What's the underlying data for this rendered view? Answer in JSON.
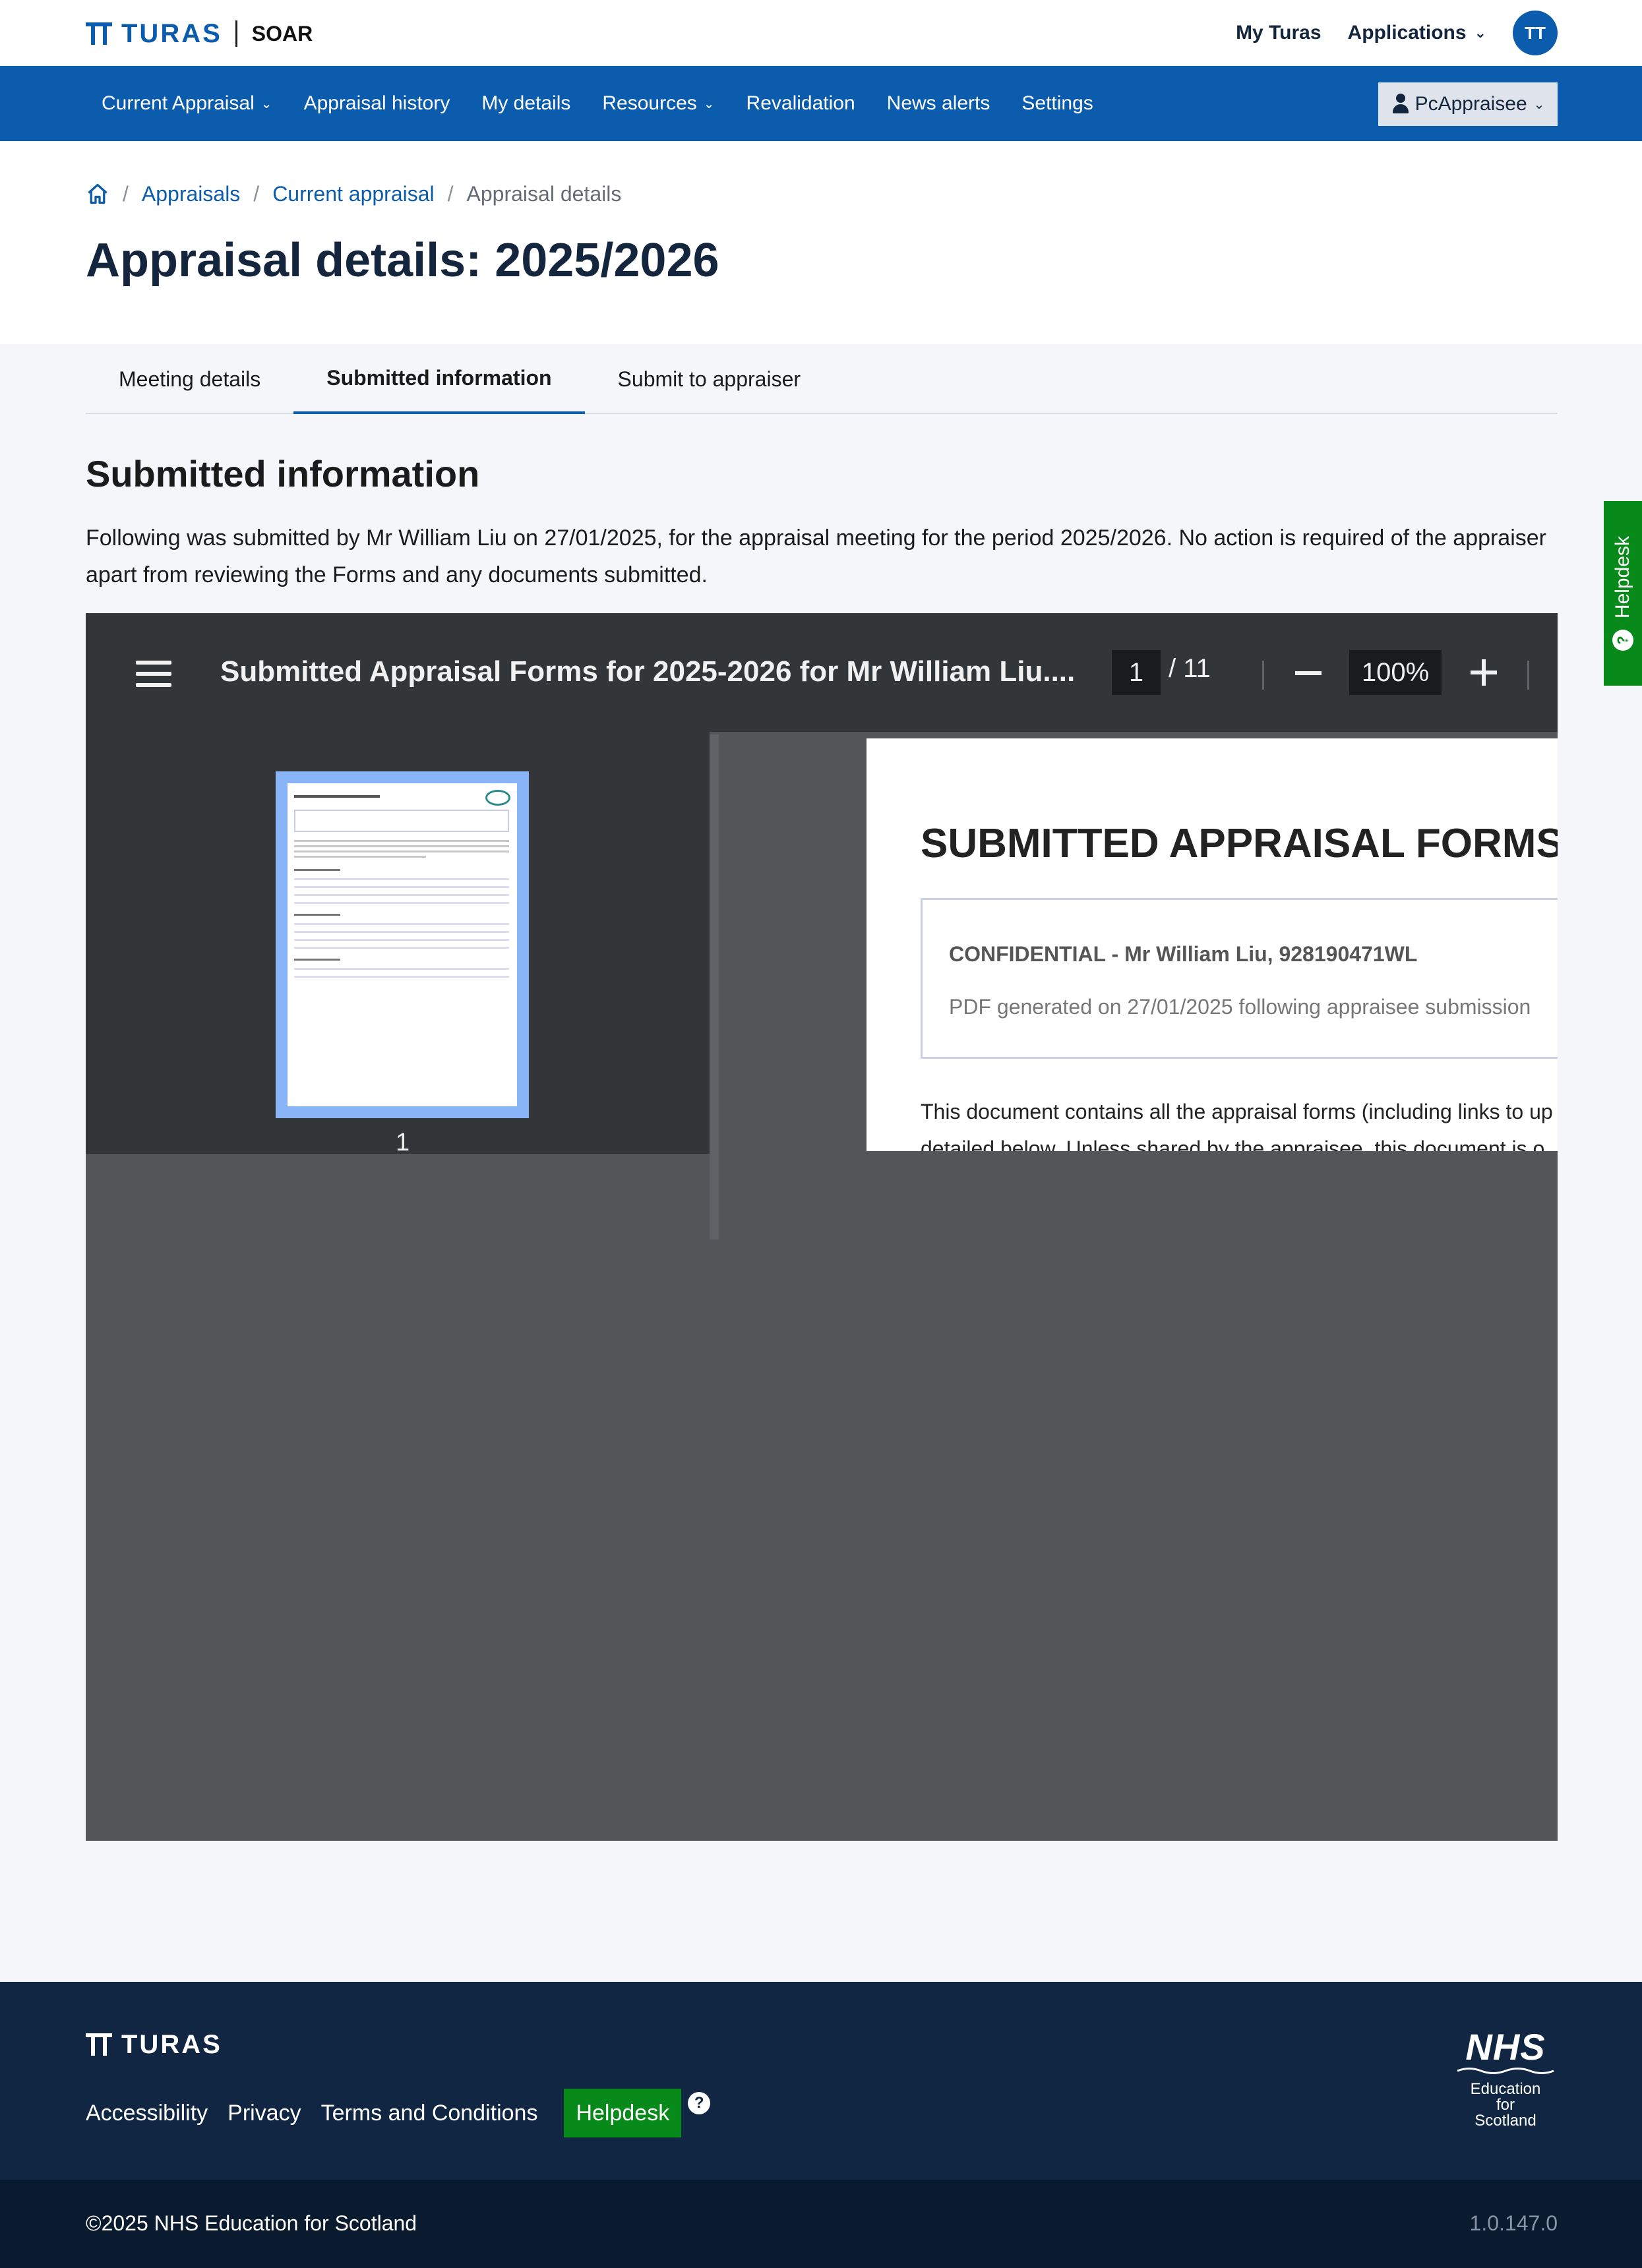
{
  "brand": {
    "name": "TURAS",
    "product": "SOAR"
  },
  "top_nav": {
    "my_turas": "My Turas",
    "applications": "Applications",
    "avatar_initials": "TT"
  },
  "main_nav": {
    "items": [
      {
        "label": "Current Appraisal",
        "dropdown": true
      },
      {
        "label": "Appraisal history",
        "dropdown": false
      },
      {
        "label": "My details",
        "dropdown": false
      },
      {
        "label": "Resources",
        "dropdown": true
      },
      {
        "label": "Revalidation",
        "dropdown": false
      },
      {
        "label": "News alerts",
        "dropdown": false
      },
      {
        "label": "Settings",
        "dropdown": false
      }
    ],
    "role_button": "PcAppraisee"
  },
  "breadcrumb": {
    "home_icon": "home-icon",
    "items": [
      "Appraisals",
      "Current appraisal"
    ],
    "current": "Appraisal details"
  },
  "page_title": "Appraisal details: 2025/2026",
  "tabs": [
    {
      "label": "Meeting details",
      "active": false
    },
    {
      "label": "Submitted information",
      "active": true
    },
    {
      "label": "Submit to appraiser",
      "active": false
    }
  ],
  "section": {
    "title": "Submitted information",
    "intro": "Following was submitted by Mr William Liu on 27/01/2025, for the appraisal meeting for the period 2025/2026. No action is required of the appraiser apart from reviewing the Forms and any documents submitted."
  },
  "pdf_viewer": {
    "title": "Submitted Appraisal Forms for 2025-2026 for Mr William Liu....",
    "current_page": "1",
    "total_pages": "/ 11",
    "zoom": "100%",
    "thumbnail_label": "1",
    "document": {
      "heading": "SUBMITTED APPRAISAL FORMS",
      "confidential": "CONFIDENTIAL - Mr William Liu, 928190471WL",
      "generated": "PDF generated on 27/01/2025 following appraisee submission",
      "para_line1": "This document contains all the appraisal forms (including links to up",
      "para_line2": "detailed below. Unless shared by the appraisee, this document is o"
    }
  },
  "helpdesk_tab": "Helpdesk",
  "footer": {
    "brand": "TURAS",
    "links": [
      "Accessibility",
      "Privacy",
      "Terms and Conditions"
    ],
    "helpdesk": "Helpdesk",
    "nhs_logo": {
      "nhs": "NHS",
      "line1": "Education",
      "line2": "for",
      "line3": "Scotland"
    },
    "copyright": "©2025 NHS Education for Scotland",
    "version": "1.0.147.0"
  },
  "colors": {
    "primary": "#0b5cad",
    "nav_bg": "#0b5cad",
    "footer_bg": "#102642",
    "helpdesk_green": "#078a19",
    "viewer_bg": "#525659",
    "viewer_toolbar": "#323639"
  }
}
